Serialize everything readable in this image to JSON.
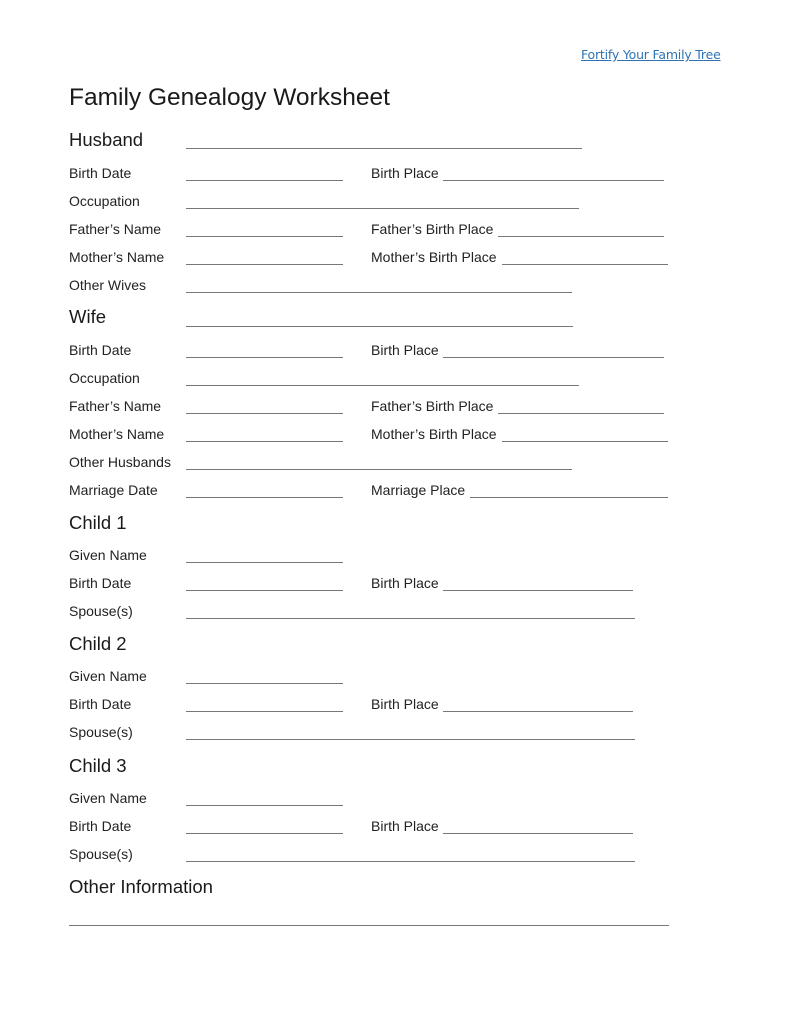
{
  "header": {
    "link_text": "Fortify Your Family Tree",
    "link_color": "#2e74b5",
    "title": "Family Genealogy Worksheet"
  },
  "husband": {
    "heading": "Husband",
    "birth_date": "Birth Date",
    "birth_place": "Birth Place",
    "occupation": "Occupation",
    "fathers_name": "Father’s Name",
    "fathers_birth_place": "Father’s Birth Place",
    "mothers_name": "Mother’s Name",
    "mothers_birth_place": "Mother’s Birth Place",
    "other_spouses": "Other Wives"
  },
  "wife": {
    "heading": "Wife",
    "birth_date": "Birth Date",
    "birth_place": "Birth Place",
    "occupation": "Occupation",
    "fathers_name": "Father’s Name",
    "fathers_birth_place": "Father’s Birth Place",
    "mothers_name": "Mother’s Name",
    "mothers_birth_place": "Mother’s Birth Place",
    "other_spouses": "Other Husbands",
    "marriage_date": "Marriage Date",
    "marriage_place": "Marriage Place"
  },
  "children": [
    {
      "heading": "Child 1",
      "given_name": "Given Name",
      "birth_date": "Birth Date",
      "birth_place": "Birth Place",
      "spouses": "Spouse(s)"
    },
    {
      "heading": "Child 2",
      "given_name": "Given Name",
      "birth_date": "Birth Date",
      "birth_place": "Birth Place",
      "spouses": "Spouse(s)"
    },
    {
      "heading": "Child 3",
      "given_name": "Given Name",
      "birth_date": "Birth Date",
      "birth_place": "Birth Place",
      "spouses": "Spouse(s)"
    }
  ],
  "other": {
    "heading": "Other Information"
  }
}
